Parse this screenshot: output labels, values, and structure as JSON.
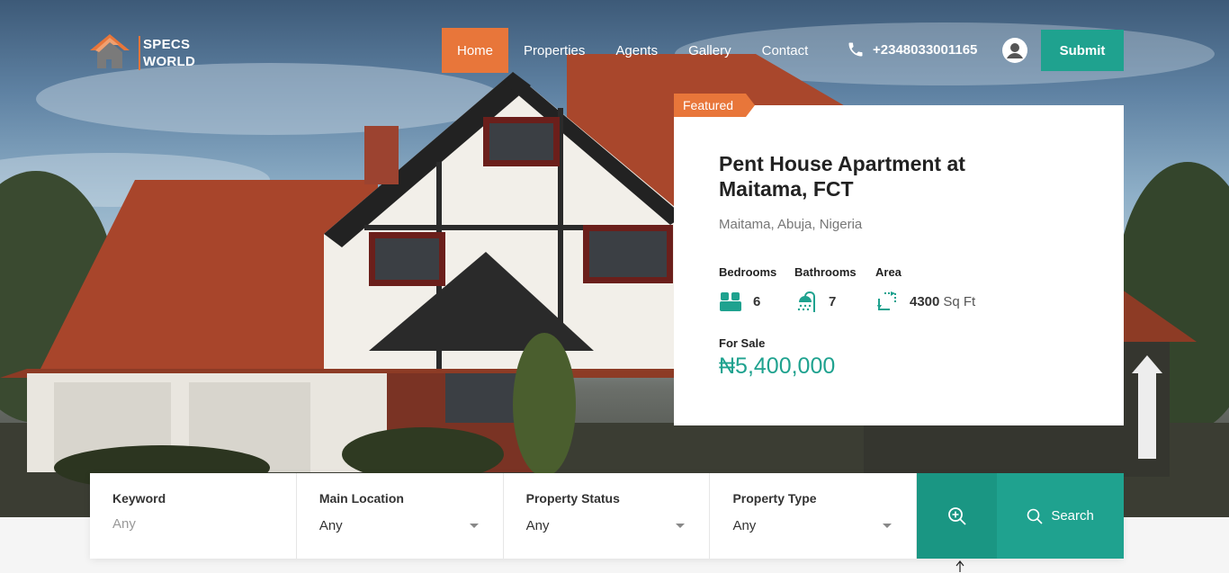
{
  "colors": {
    "accent_orange": "#e8763a",
    "accent_teal": "#1fa28f",
    "teal_dark": "#1a9683"
  },
  "header": {
    "logo": {
      "line1": "SPECS",
      "line2": "WORLD",
      "icon": "house-logo-icon"
    },
    "nav": [
      {
        "label": "Home",
        "active": true
      },
      {
        "label": "Properties",
        "active": false
      },
      {
        "label": "Agents",
        "active": false
      },
      {
        "label": "Gallery",
        "active": false
      },
      {
        "label": "Contact",
        "active": false
      }
    ],
    "phone": {
      "icon": "phone-icon",
      "number": "+2348033001165"
    },
    "user_icon": "user-account-icon",
    "submit_label": "Submit"
  },
  "featured": {
    "badge": "Featured",
    "title": "Pent House Apartment at Maitama, FCT",
    "address": "Maitama, Abuja, Nigeria",
    "features": [
      {
        "label": "Bedrooms",
        "icon": "bed-icon",
        "value": "6",
        "unit": ""
      },
      {
        "label": "Bathrooms",
        "icon": "shower-icon",
        "value": "7",
        "unit": ""
      },
      {
        "label": "Area",
        "icon": "area-icon",
        "value": "4300",
        "unit": "Sq Ft"
      }
    ],
    "status_label": "For Sale",
    "price": "₦5,400,000"
  },
  "search": {
    "keyword": {
      "label": "Keyword",
      "placeholder": "Any"
    },
    "location": {
      "label": "Main Location",
      "value": "Any"
    },
    "status": {
      "label": "Property Status",
      "value": "Any"
    },
    "type": {
      "label": "Property Type",
      "value": "Any"
    },
    "advanced_icon": "zoom-in-icon",
    "button_label": "Search",
    "button_icon": "search-icon"
  }
}
